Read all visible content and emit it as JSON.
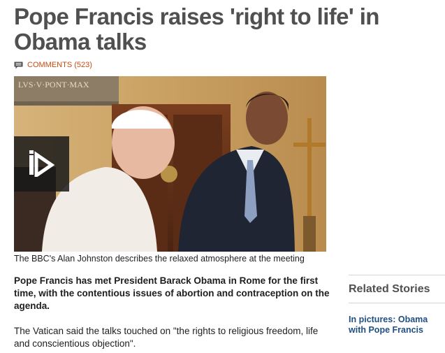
{
  "article": {
    "headline": "Pope Francis raises 'right to life' in Obama talks",
    "comments_label": "COMMENTS (523)",
    "media": {
      "inscription": "LVS·V·PONT·MAX",
      "play_icon": "play-icon",
      "caption": "The BBC's Alan Johnston describes the relaxed atmosphere at the meeting"
    },
    "lead": "Pope Francis has met President Barack Obama in Rome for the first time, with the contentious issues of abortion and contraception on the agenda.",
    "paragraph_1": "The Vatican said the talks touched on \"the rights to religious freedom, life and conscientious objection\"."
  },
  "related": {
    "title": "Related Stories",
    "links": [
      {
        "label": "In pictures: Obama with Pope Francis"
      }
    ]
  },
  "colors": {
    "headline": "#505050",
    "comments": "#c74a10",
    "link": "#1f4f82"
  }
}
